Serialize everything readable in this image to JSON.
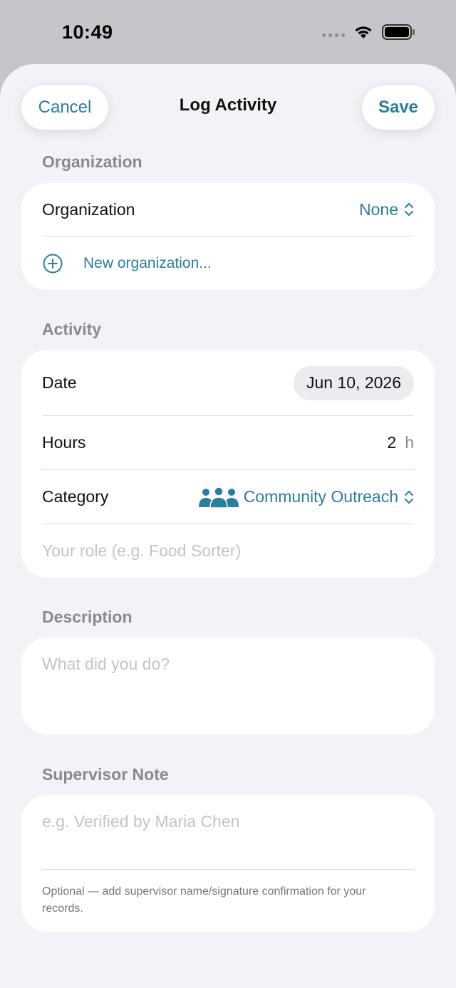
{
  "status_bar": {
    "time": "10:49"
  },
  "nav": {
    "cancel_label": "Cancel",
    "title": "Log Activity",
    "save_label": "Save"
  },
  "organization_section": {
    "header": "Organization",
    "picker_label": "Organization",
    "picker_value": "None",
    "new_org_label": "New organization..."
  },
  "activity_section": {
    "header": "Activity",
    "date_label": "Date",
    "date_value": "Jun 10, 2026",
    "hours_label": "Hours",
    "hours_value": "2",
    "hours_unit": "h",
    "category_label": "Category",
    "category_value": "Community Outreach",
    "category_icon": "people-group-icon",
    "role_placeholder": "Your role (e.g. Food Sorter)"
  },
  "description_section": {
    "header": "Description",
    "placeholder": "What did you do?"
  },
  "supervisor_section": {
    "header": "Supervisor Note",
    "placeholder": "e.g. Verified by Maria Chen",
    "footnote": "Optional — add supervisor name/signature confirmation for your records."
  },
  "colors": {
    "accent": "#2a7f9e",
    "background": "#f2f2f7",
    "card": "#ffffff"
  }
}
